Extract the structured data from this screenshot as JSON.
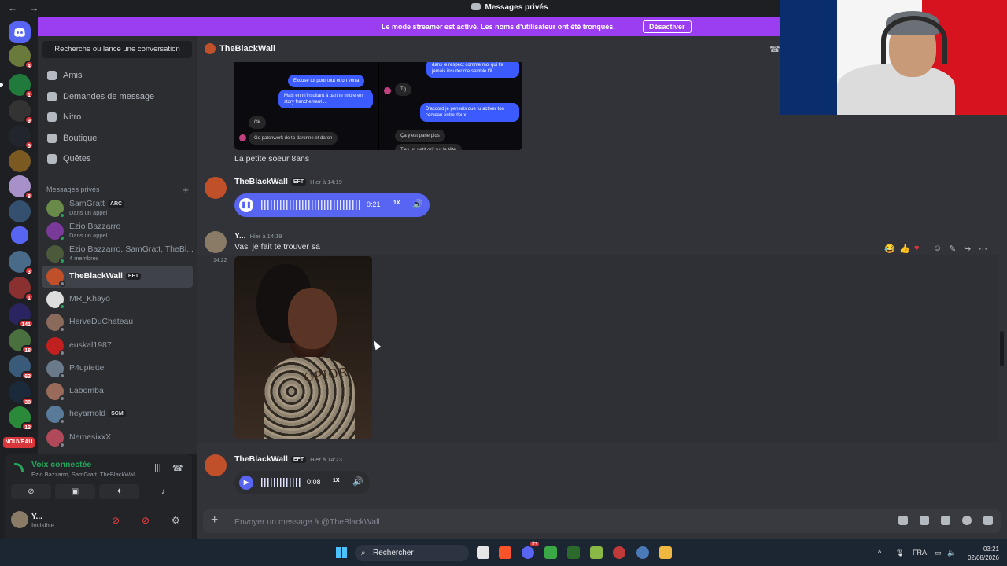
{
  "window": {
    "title": "Messages privés",
    "nav_arrows": "← →"
  },
  "banner": {
    "text": "Le mode streamer est activé. Les noms d'utilisateur ont été tronqués.",
    "button": "Désactiver"
  },
  "guilds": {
    "badges": [
      "4",
      "1",
      "9",
      "5",
      "8",
      "3",
      "1",
      "141",
      "18",
      "63",
      "38",
      "13"
    ],
    "new_label": "NOUVEAU"
  },
  "sidebar": {
    "search": "Recherche ou lance une conversation",
    "nav": [
      {
        "label": "Amis",
        "icon": "friends-icon"
      },
      {
        "label": "Demandes de message",
        "icon": "mail-icon"
      },
      {
        "label": "Nitro",
        "icon": "nitro-icon"
      },
      {
        "label": "Boutique",
        "icon": "shop-icon"
      },
      {
        "label": "Quêtes",
        "icon": "quest-icon"
      }
    ],
    "section_title": "Messages privés",
    "add_dm": "+",
    "dms": [
      {
        "name": "SamGratt",
        "tag": "ARC",
        "sub": "Dans un appel"
      },
      {
        "name": "Ezio Bazzarro",
        "sub": "Dans un appel"
      },
      {
        "name": "Ezio Bazzarro, SamGratt, TheBl...",
        "sub": "4 membres"
      },
      {
        "name": "TheBlackWall",
        "tag": "EFT"
      },
      {
        "name": "MR_Khayo"
      },
      {
        "name": "HerveDuChateau"
      },
      {
        "name": "euskal1987"
      },
      {
        "name": "P4upiette"
      },
      {
        "name": "Labomba"
      },
      {
        "name": "heyarnold",
        "tag": "SCM"
      },
      {
        "name": "NemesixxX"
      }
    ]
  },
  "voice_panel": {
    "status": "Voix connectée",
    "members": "Ezio Bazzarro, SamGratt, TheBlackWall"
  },
  "user_panel": {
    "name": "Y...",
    "status": "Invisible"
  },
  "chat": {
    "header_name": "TheBlackWall",
    "screenshot_bubbles": {
      "left": [
        "Excuse toi pour tout et on verra",
        "Mais en m'insultant à part te mittre en story franchement ...",
        "Ok",
        "Go patchwork de ta daronne et daron"
      ],
      "right": [
        "dans le respect comme moi qui t'a jamais insulter me semble t'il",
        "Tg",
        "D'accord je pensais que tu activer ton cerveau entre deux",
        "Ça y est parle plus",
        "T'es un petit grif sur la tête"
      ]
    },
    "messages": [
      {
        "text": "La petite soeur 8ans"
      },
      {
        "author": "TheBlackWall",
        "tag": "EFT",
        "time": "Hier à 14:19",
        "voice": {
          "duration": "0:21",
          "speed": "1X"
        }
      },
      {
        "author": "Y...",
        "time": "Hier à 14:19",
        "text": "Vasi je fait te trouver sa",
        "side_time": "14:22",
        "photo_text": "OPIOR"
      },
      {
        "author": "TheBlackWall",
        "tag": "EFT",
        "time": "Hier à 14:23",
        "voice": {
          "duration": "0:08",
          "speed": "1X"
        }
      }
    ],
    "composer_placeholder": "Envoyer un message à @TheBlackWall"
  },
  "taskbar": {
    "search": "Rechercher",
    "discord_badge": "9+",
    "lang": "FRA",
    "time": "03:21",
    "date": "02/08/2026"
  }
}
